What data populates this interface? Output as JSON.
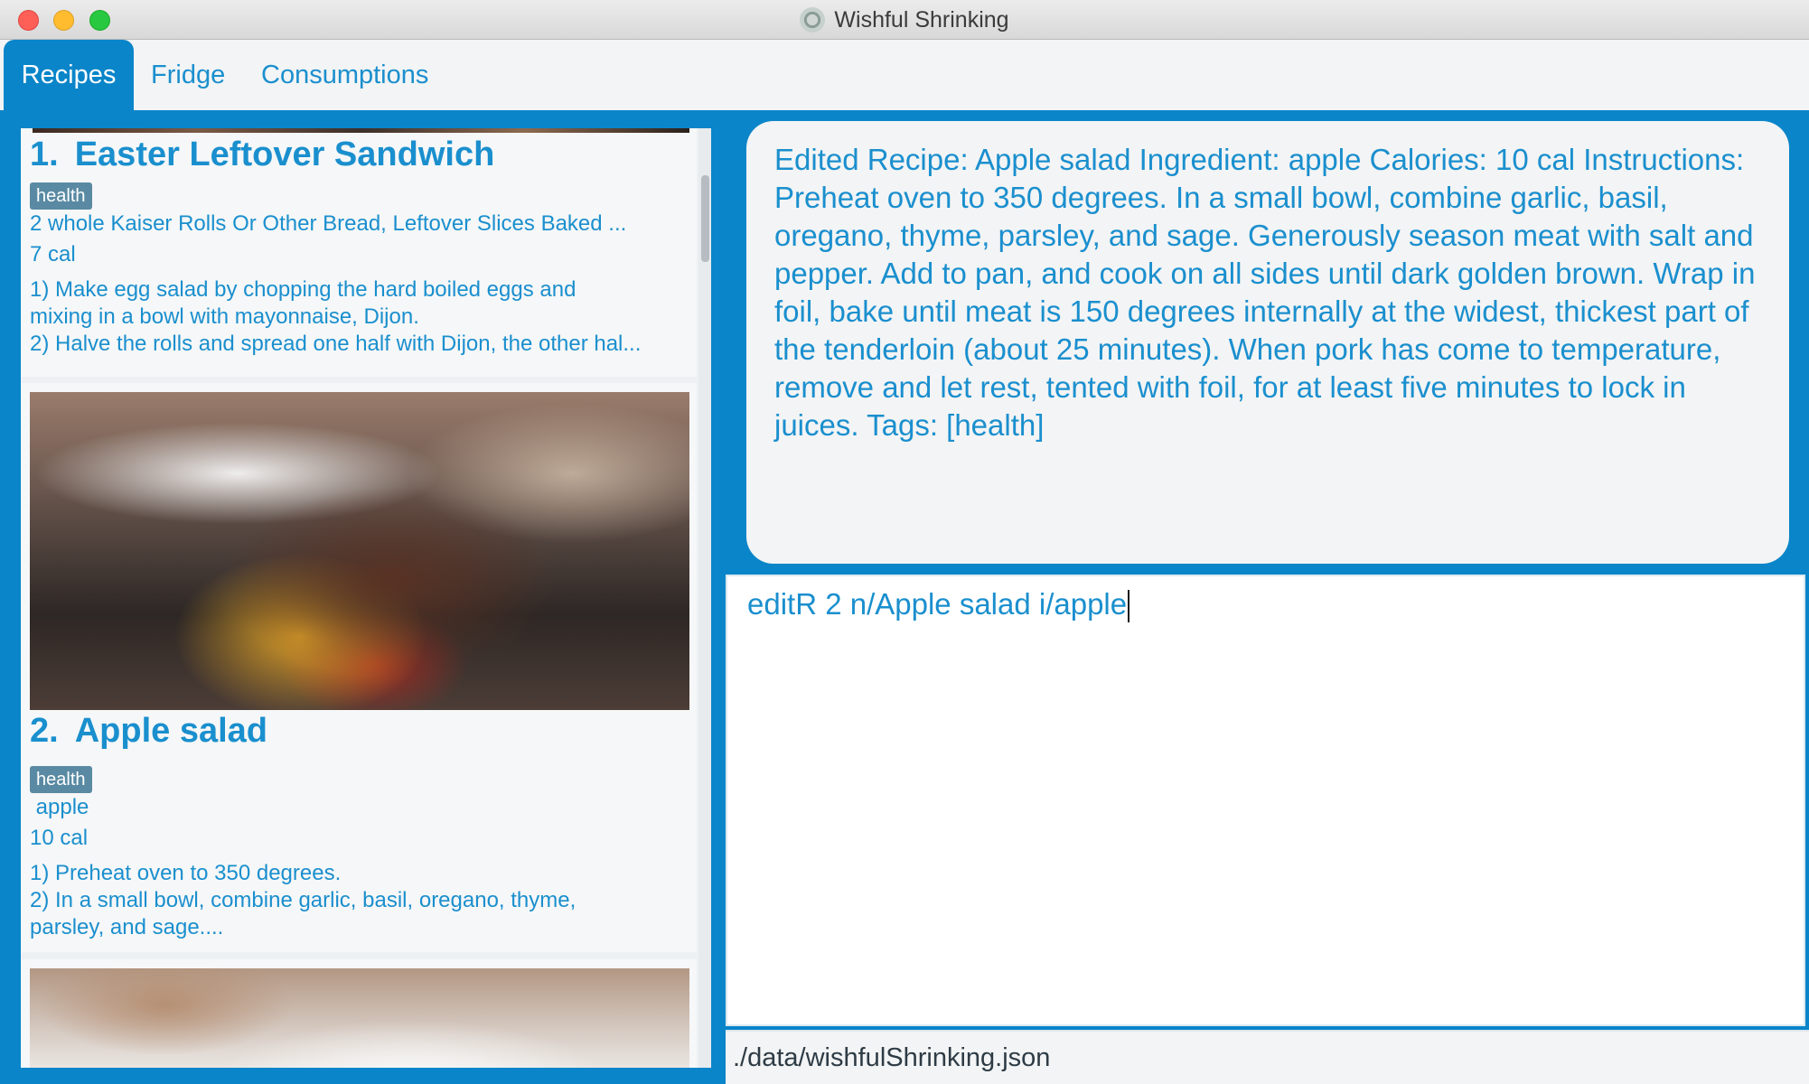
{
  "window": {
    "title": "Wishful Shrinking"
  },
  "tabs": [
    {
      "label": "Recipes",
      "active": true
    },
    {
      "label": "Fridge",
      "active": false
    },
    {
      "label": "Consumptions",
      "active": false
    }
  ],
  "recipes": [
    {
      "index": "1.",
      "name": "Easter Leftover Sandwich",
      "tag": "health",
      "ingredients": "2 whole Kaiser Rolls Or Other Bread, Leftover Slices Baked ...",
      "calories": "7 cal",
      "steps": [
        "1) Make egg salad by chopping the hard boiled eggs and",
        "mixing in a bowl with mayonnaise, Dijon.",
        "2) Halve the rolls and spread one half with Dijon, the other hal..."
      ]
    },
    {
      "index": "2.",
      "name": "Apple salad",
      "tag": "health",
      "ingredients": " apple",
      "calories": "10 cal",
      "steps": [
        "1) Preheat oven to 350 degrees.",
        "2) In a small bowl, combine garlic, basil, oregano, thyme,",
        "parsley, and sage...."
      ]
    }
  ],
  "result_message": "Edited Recipe: Apple salad Ingredient:  apple Calories: 10 cal Instructions: Preheat oven to 350 degrees.  In a small bowl, combine garlic, basil, oregano, thyme, parsley, and sage.  Generously season meat with salt and pepper.  Add to pan, and cook on all sides until dark golden brown.  Wrap in foil, bake until meat is 150 degrees internally at the widest, thickest part of the tenderloin (about 25 minutes).  When pork has come to temperature, remove and let rest, tented with foil, for at least five minutes to lock in juices. Tags: [health]",
  "command_input": "editR 2 n/Apple salad i/apple",
  "status_bar": {
    "path": "./data/wishfulShrinking.json"
  },
  "colors": {
    "accent": "#0a85c9",
    "text": "#1a8fce",
    "tag_bg": "#5a8aa3"
  }
}
